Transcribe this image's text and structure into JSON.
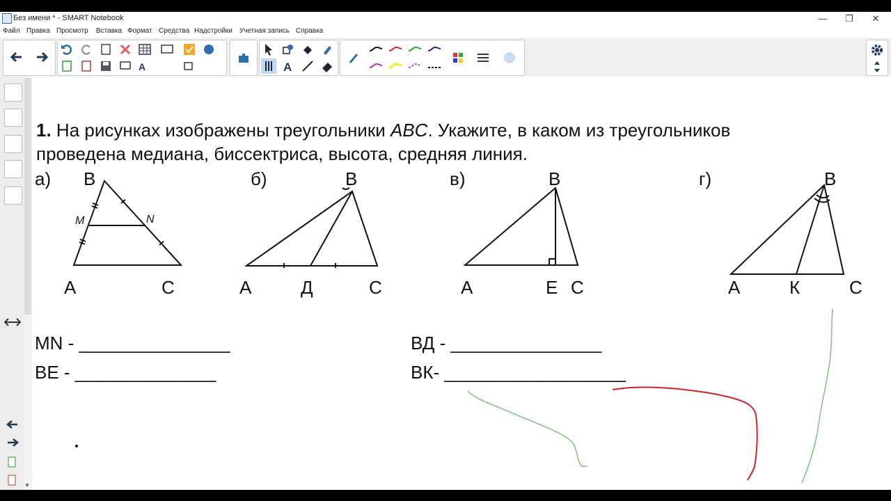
{
  "window": {
    "title": "Без имени * - SMART Notebook"
  },
  "menu": [
    "Файл",
    "Правка",
    "Просмотр",
    "Вставка",
    "Формат",
    "Средства",
    "Надстройки",
    "Учетная запись",
    "Справка"
  ],
  "task": {
    "number": "1.",
    "line1_a": "На рисунках изображены треугольники",
    "line1_abc": "ABC",
    "line1_b": ". Укажите, в каком из треугольников",
    "line2": "проведена медиана, биссектриса, высота, средняя линия."
  },
  "figures": {
    "a": {
      "label": "а)",
      "B": "В",
      "A": "А",
      "C": "С",
      "M": "M",
      "N": "N"
    },
    "b": {
      "label": "б)",
      "B": "В",
      "A": "А",
      "D": "Д",
      "C": "С"
    },
    "v": {
      "label": "в)",
      "B": "В",
      "A": "А",
      "E": "Е",
      "C": "С"
    },
    "g": {
      "label": "г)",
      "B": "В",
      "A": "А",
      "K": "К",
      "C": "С"
    }
  },
  "answers": {
    "mn": "MN  - _______________",
    "bd": "ВД - _______________",
    "be": "ВЕ - ______________",
    "bk": "ВК- __________________"
  },
  "colors": {
    "green": "#7dc47a",
    "red": "#d42020",
    "ink": "#111111"
  }
}
